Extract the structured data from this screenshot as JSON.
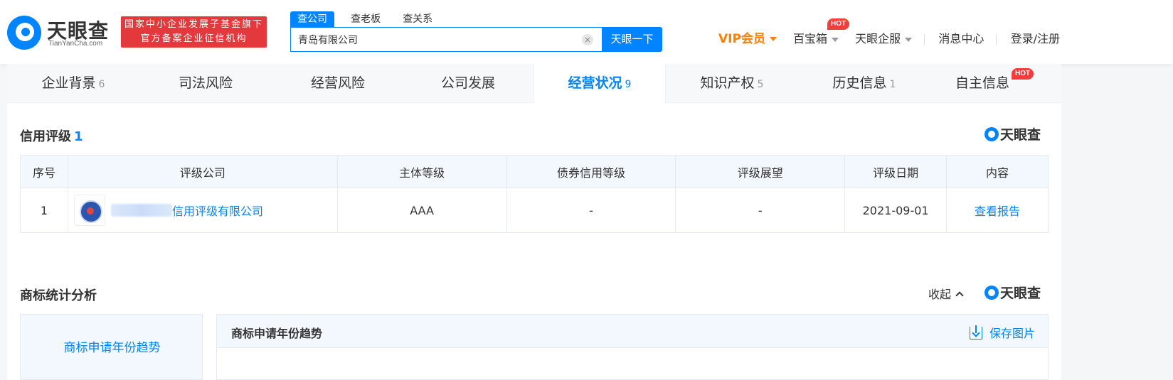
{
  "header": {
    "logo_text": "天眼查",
    "logo_sub": "TianYanCha.com",
    "badge_line1": "国家中小企业发展子基金旗下",
    "badge_line2": "官方备案企业征信机构",
    "search_tabs": [
      "查公司",
      "查老板",
      "查关系"
    ],
    "search_value": "青岛有限公司",
    "search_button": "天眼一下",
    "clear_glyph": "×",
    "nav": {
      "vip": "VIP会员",
      "baobao": "百宝箱",
      "hot": "HOT",
      "enterprise": "天眼企服",
      "messages": "消息中心",
      "login": "登录/注册"
    }
  },
  "tabs": [
    {
      "label": "企业背景",
      "count": "6"
    },
    {
      "label": "司法风险",
      "count": ""
    },
    {
      "label": "经营风险",
      "count": ""
    },
    {
      "label": "公司发展",
      "count": ""
    },
    {
      "label": "经营状况",
      "count": "9"
    },
    {
      "label": "知识产权",
      "count": "5"
    },
    {
      "label": "历史信息",
      "count": "1"
    },
    {
      "label": "自主信息",
      "count": ""
    }
  ],
  "tab_hot": "HOT",
  "credit": {
    "title": "信用评级",
    "count": "1",
    "brand": "天眼查",
    "columns": [
      "序号",
      "评级公司",
      "主体等级",
      "债券信用等级",
      "评级展望",
      "评级日期",
      "内容"
    ],
    "rows": [
      {
        "index": "1",
        "company": "信用评级有限公司",
        "subject_level": "AAA",
        "bond_level": "-",
        "outlook": "-",
        "date": "2021-09-01",
        "content": "查看报告"
      }
    ]
  },
  "trademark": {
    "title": "商标统计分析",
    "collapse": "收起",
    "brand": "天眼查",
    "side_item": "商标申请年份趋势",
    "panel_title": "商标申请年份趋势",
    "save_image": "保存图片"
  },
  "colors": {
    "accent": "#0084ff",
    "red": "#e4393c",
    "vip": "#ff7e00"
  }
}
